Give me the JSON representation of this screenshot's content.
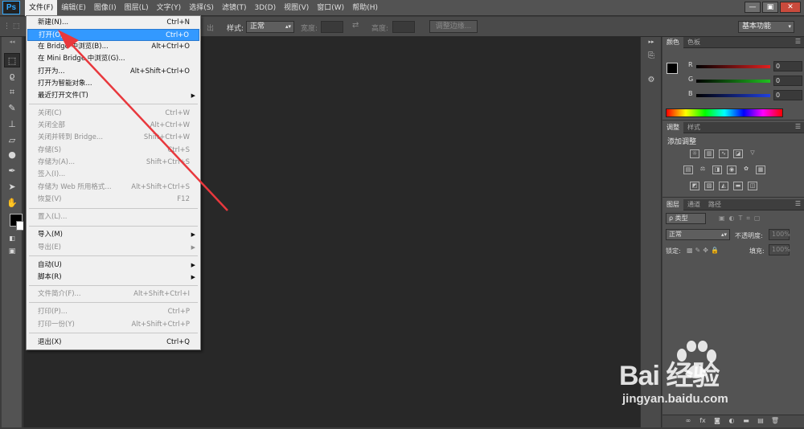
{
  "app": {
    "logo": "Ps",
    "logo_color": "#31a8ff"
  },
  "menubar": {
    "items": [
      "文件(F)",
      "编辑(E)",
      "图像(I)",
      "图层(L)",
      "文字(Y)",
      "选择(S)",
      "滤镜(T)",
      "3D(D)",
      "视图(V)",
      "窗口(W)",
      "帮助(H)"
    ],
    "active_index": 0
  },
  "window_controls": {
    "minimize": "—",
    "restore": "▣",
    "close": "✕"
  },
  "options": {
    "feather_suffix": "出",
    "style_label": "样式:",
    "style_value": "正常",
    "width_label": "宽度:",
    "height_label": "高度:",
    "refine_edge": "调整边缘...",
    "workspace": "基本功能"
  },
  "file_menu": {
    "items": [
      {
        "label": "新建(N)...",
        "shortcut": "Ctrl+N",
        "enabled": true
      },
      {
        "label": "打开(O)...",
        "shortcut": "Ctrl+O",
        "enabled": true,
        "highlighted": true
      },
      {
        "label": "在 Bridge 中浏览(B)...",
        "shortcut": "Alt+Ctrl+O",
        "enabled": true
      },
      {
        "label": "在 Mini Bridge 中浏览(G)...",
        "shortcut": "",
        "enabled": true
      },
      {
        "label": "打开为...",
        "shortcut": "Alt+Shift+Ctrl+O",
        "enabled": true
      },
      {
        "label": "打开为智能对象...",
        "shortcut": "",
        "enabled": true
      },
      {
        "label": "最近打开文件(T)",
        "shortcut": "",
        "enabled": true,
        "submenu": true
      },
      {
        "label": "关闭(C)",
        "shortcut": "Ctrl+W",
        "enabled": false
      },
      {
        "label": "关闭全部",
        "shortcut": "Alt+Ctrl+W",
        "enabled": false
      },
      {
        "label": "关闭并转到 Bridge...",
        "shortcut": "Shift+Ctrl+W",
        "enabled": false
      },
      {
        "label": "存储(S)",
        "shortcut": "Ctrl+S",
        "enabled": false
      },
      {
        "label": "存储为(A)...",
        "shortcut": "Shift+Ctrl+S",
        "enabled": false
      },
      {
        "label": "签入(I)...",
        "shortcut": "",
        "enabled": false
      },
      {
        "label": "存储为 Web 所用格式...",
        "shortcut": "Alt+Shift+Ctrl+S",
        "enabled": false
      },
      {
        "label": "恢复(V)",
        "shortcut": "F12",
        "enabled": false
      },
      {
        "label": "置入(L)...",
        "shortcut": "",
        "enabled": false
      },
      {
        "label": "导入(M)",
        "shortcut": "",
        "enabled": true,
        "submenu": true
      },
      {
        "label": "导出(E)",
        "shortcut": "",
        "enabled": false,
        "submenu": true
      },
      {
        "label": "自动(U)",
        "shortcut": "",
        "enabled": true,
        "submenu": true
      },
      {
        "label": "脚本(R)",
        "shortcut": "",
        "enabled": true,
        "submenu": true
      },
      {
        "label": "文件简介(F)...",
        "shortcut": "Alt+Shift+Ctrl+I",
        "enabled": false
      },
      {
        "label": "打印(P)...",
        "shortcut": "Ctrl+P",
        "enabled": false
      },
      {
        "label": "打印一份(Y)",
        "shortcut": "Alt+Shift+Ctrl+P",
        "enabled": false
      },
      {
        "label": "退出(X)",
        "shortcut": "Ctrl+Q",
        "enabled": true
      }
    ]
  },
  "color_panel": {
    "tabs": [
      "颜色",
      "色板"
    ],
    "channels": [
      {
        "label": "R",
        "value": "0",
        "color": "#e02020"
      },
      {
        "label": "G",
        "value": "0",
        "color": "#20c020"
      },
      {
        "label": "B",
        "value": "0",
        "color": "#2040e0"
      }
    ]
  },
  "adjustments_panel": {
    "tabs": [
      "调整",
      "样式"
    ],
    "title": "添加调整"
  },
  "layers_panel": {
    "tabs": [
      "图层",
      "通道",
      "路径"
    ],
    "filter_label": "ρ 类型",
    "blend_mode": "正常",
    "opacity_label": "不透明度:",
    "opacity_value": "100%",
    "lock_label": "锁定:",
    "fill_label": "填充:",
    "fill_value": "100%"
  },
  "watermark": {
    "brand": "Bai  经验",
    "url": "jingyan.baidu.com"
  },
  "annotation": {
    "arrow_color": "#e8383d"
  }
}
